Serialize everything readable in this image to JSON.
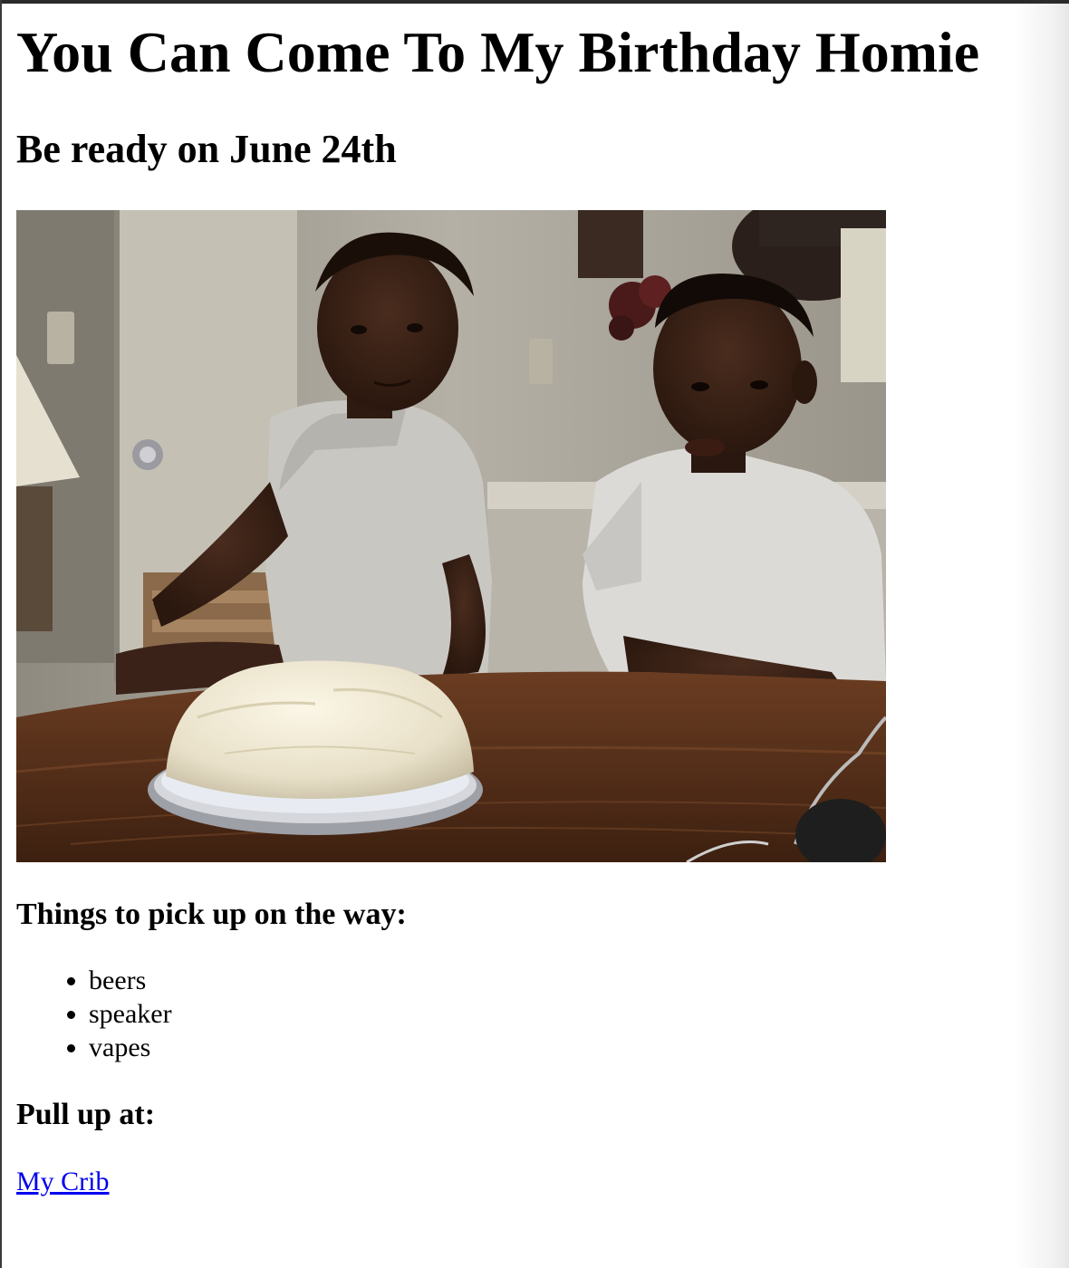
{
  "title": "You Can Come To My Birthday Homie",
  "subtitle": "Be ready on June 24th",
  "image": {
    "description": "two-kids-with-birthday-cake"
  },
  "pickup": {
    "heading": "Things to pick up on the way:",
    "items": [
      "beers",
      "speaker",
      "vapes"
    ]
  },
  "location": {
    "heading": "Pull up at:",
    "link_text": "My Crib"
  },
  "colors": {
    "link": "#0000ee",
    "text": "#000000",
    "background": "#ffffff"
  }
}
